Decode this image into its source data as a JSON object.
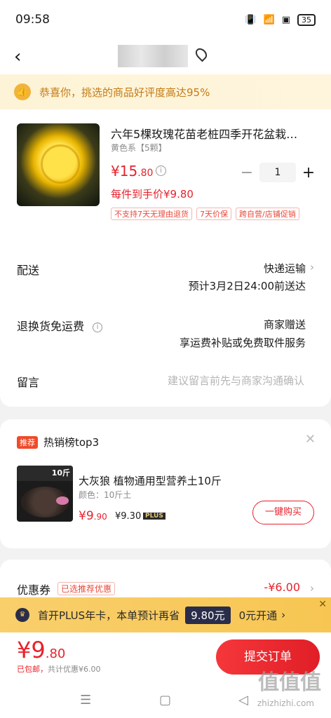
{
  "status": {
    "time": "09:58",
    "battery": "35"
  },
  "banner": {
    "icon": "thumbs-up-icon",
    "text": "恭喜你，挑选的商品好评度高达95%"
  },
  "product": {
    "title": "六年5棵玫瑰花苗老桩四季开花盆栽…",
    "spec": "黄色系【5颗】",
    "price_int": "¥15",
    "price_dec": ".80",
    "quantity": "1",
    "unit_price": "每件到手价¥9.80",
    "tags": [
      "不支持7天无理由退货",
      "7天价保",
      "跨自营/店铺促销"
    ]
  },
  "delivery": {
    "label": "配送",
    "method": "快递运输",
    "eta": "预计3月2日24:00前送达"
  },
  "returns": {
    "label": "退换货免运费",
    "value": "商家赠送",
    "detail": "享运费补贴或免费取件服务"
  },
  "message": {
    "label": "留言",
    "placeholder": "建议留言前先与商家沟通确认"
  },
  "recommend": {
    "badge": "推荐",
    "title": "热销榜top3",
    "img_header": "10斤",
    "name": "大灰狼 植物通用型营养土10斤",
    "spec": "颜色：10斤土",
    "price_int": "¥9",
    "price_dec": ".90",
    "plus_price": "¥9.30",
    "plus_label": "PLUS",
    "buy_label": "一键购买"
  },
  "coupon": {
    "label": "优惠券",
    "tag": "已选推荐优惠",
    "value": "-¥6.00"
  },
  "plus_bar": {
    "text": "首开PLUS年卡，本单预计再省",
    "amount": "9.80元",
    "open": "0元开通"
  },
  "footer": {
    "total_int": "¥9",
    "total_dec": ".80",
    "shipping": "已包邮，",
    "discount": "共计优惠¥6.00",
    "submit": "提交订单"
  },
  "watermark": {
    "main": "值值值",
    "sub": "zhizhizhi.com"
  }
}
